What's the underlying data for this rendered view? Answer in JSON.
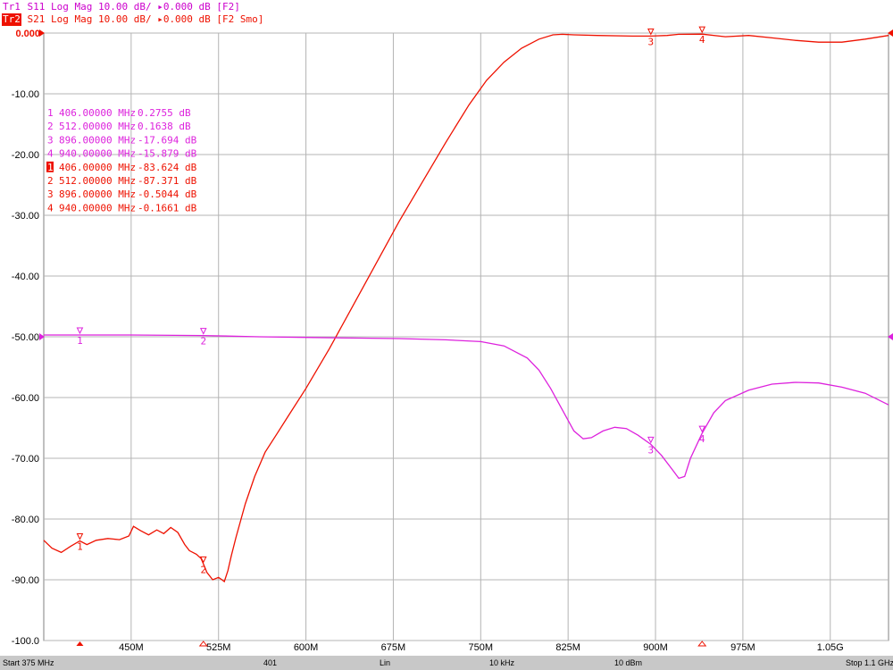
{
  "header": {
    "tr1_tag": "Tr1",
    "tr1_text": " S11 Log Mag 10.00 dB/ ▸0.000 dB [F2]",
    "tr2_tag": "Tr2",
    "tr2_text": " S21 Log Mag 10.00 dB/ ▸0.000 dB [F2 Smo]"
  },
  "footer": {
    "start": "Start 375 MHz",
    "points": "401",
    "sweep": "Lin",
    "ifbw": "10 kHz",
    "power": "10 dBm",
    "stop": "Stop 1.1 GHz"
  },
  "colors": {
    "s11": "#dd22dd",
    "s21": "#ee1100",
    "grid": "#b4b4b4",
    "axis_text": "#000000"
  },
  "markers": {
    "s11": [
      {
        "id": "1",
        "freq": "406.00000 MHz",
        "value": " 0.2755 dB"
      },
      {
        "id": "2",
        "freq": "512.00000 MHz",
        "value": " 0.1638 dB"
      },
      {
        "id": "3",
        "freq": "896.00000 MHz",
        "value": "-17.694 dB"
      },
      {
        "id": "4",
        "freq": "940.00000 MHz",
        "value": "-15.879 dB"
      }
    ],
    "s21": [
      {
        "id": "1",
        "freq": "406.00000 MHz",
        "value": "-83.624 dB"
      },
      {
        "id": "2",
        "freq": "512.00000 MHz",
        "value": "-87.371 dB"
      },
      {
        "id": "3",
        "freq": "896.00000 MHz",
        "value": "-0.5044 dB"
      },
      {
        "id": "4",
        "freq": "940.00000 MHz",
        "value": "-0.1661 dB"
      }
    ]
  },
  "chart_data": {
    "type": "line",
    "x_unit": "MHz",
    "xlim": [
      375,
      1100
    ],
    "ylim": [
      -100,
      0
    ],
    "grid": true,
    "x_ticks": [
      450,
      525,
      600,
      675,
      750,
      825,
      900,
      975,
      1050
    ],
    "x_tick_labels": [
      "450M",
      "525M",
      "600M",
      "675M",
      "750M",
      "825M",
      "900M",
      "975M",
      "1.05G"
    ],
    "y_ticks": [
      0,
      -10,
      -20,
      -30,
      -40,
      -50,
      -60,
      -70,
      -80,
      -90,
      -100
    ],
    "y_tick_labels": [
      "0.000",
      "-10.00",
      "-20.00",
      "-30.00",
      "-40.00",
      "-50.00",
      "-60.00",
      "-70.00",
      "-80.00",
      "-90.00",
      "-100.0"
    ],
    "series": [
      {
        "name": "S21",
        "x": [
          375,
          382,
          390,
          398,
          406,
          412,
          420,
          430,
          440,
          448,
          452,
          458,
          465,
          472,
          478,
          484,
          490,
          496,
          500,
          506,
          510,
          512,
          515,
          520,
          525,
          528,
          530,
          533,
          536,
          540,
          548,
          556,
          565,
          575,
          585,
          600,
          620,
          640,
          660,
          680,
          700,
          720,
          740,
          755,
          770,
          785,
          800,
          812,
          820,
          830,
          850,
          880,
          896,
          910,
          920,
          940,
          960,
          980,
          1000,
          1020,
          1040,
          1060,
          1080,
          1100
        ],
        "y": [
          -83.5,
          -84.8,
          -85.5,
          -84.5,
          -83.6,
          -84.2,
          -83.5,
          -83.2,
          -83.4,
          -82.8,
          -81.2,
          -81.9,
          -82.6,
          -81.8,
          -82.4,
          -81.4,
          -82.2,
          -84.2,
          -85.2,
          -85.8,
          -86.5,
          -87.4,
          -88.8,
          -90,
          -89.6,
          -90,
          -90.3,
          -88.5,
          -86,
          -83,
          -77.5,
          -73,
          -69,
          -66,
          -63,
          -58.5,
          -52,
          -45,
          -38,
          -31,
          -24.5,
          -18,
          -11.8,
          -7.8,
          -4.8,
          -2.5,
          -1,
          -0.3,
          -0.2,
          -0.3,
          -0.4,
          -0.5,
          -0.5,
          -0.4,
          -0.2,
          -0.17,
          -0.6,
          -0.4,
          -0.8,
          -1.2,
          -1.5,
          -1.5,
          -1.0,
          -0.4
        ]
      },
      {
        "name": "S11",
        "x": [
          375,
          406,
          450,
          512,
          560,
          600,
          640,
          680,
          720,
          750,
          770,
          790,
          800,
          810,
          820,
          830,
          838,
          845,
          855,
          865,
          875,
          885,
          896,
          905,
          915,
          920,
          925,
          930,
          940,
          950,
          960,
          980,
          1000,
          1020,
          1040,
          1060,
          1080,
          1100
        ],
        "y": [
          -49.7,
          -49.7,
          -49.7,
          -49.8,
          -50,
          -50.1,
          -50.2,
          -50.3,
          -50.5,
          -50.8,
          -51.5,
          -53.5,
          -55.5,
          -58.5,
          -62,
          -65.5,
          -66.8,
          -66.6,
          -65.5,
          -64.9,
          -65.1,
          -66.2,
          -67.7,
          -69.5,
          -72,
          -73.3,
          -73,
          -70,
          -65.9,
          -62.5,
          -60.5,
          -58.8,
          -57.8,
          -57.5,
          -57.6,
          -58.3,
          -59.3,
          -61.2
        ]
      }
    ]
  }
}
